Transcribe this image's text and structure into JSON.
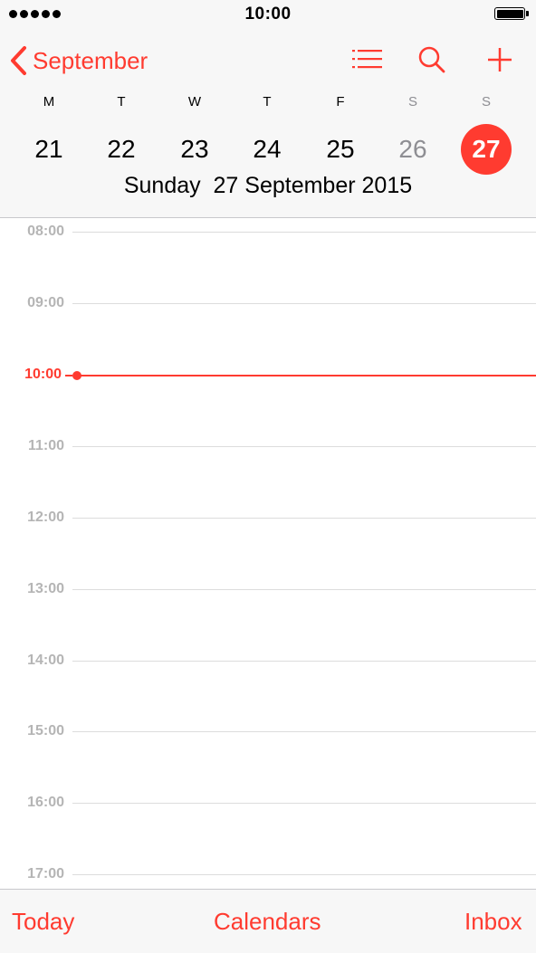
{
  "status_bar": {
    "time": "10:00",
    "signal_bars": 5
  },
  "nav": {
    "back_label": "September",
    "icons": [
      "list-icon",
      "search-icon",
      "plus-icon"
    ]
  },
  "week": {
    "days": [
      {
        "letter": "M",
        "number": "21",
        "weekend": false,
        "selected": false
      },
      {
        "letter": "T",
        "number": "22",
        "weekend": false,
        "selected": false
      },
      {
        "letter": "W",
        "number": "23",
        "weekend": false,
        "selected": false
      },
      {
        "letter": "T",
        "number": "24",
        "weekend": false,
        "selected": false
      },
      {
        "letter": "F",
        "number": "25",
        "weekend": false,
        "selected": false
      },
      {
        "letter": "S",
        "number": "26",
        "weekend": true,
        "selected": false
      },
      {
        "letter": "S",
        "number": "27",
        "weekend": true,
        "selected": true
      }
    ],
    "date_title": "Sunday  27 September 2015"
  },
  "timeline": {
    "hours": [
      "08:00",
      "09:00",
      "10:00",
      "11:00",
      "12:00",
      "13:00",
      "14:00",
      "15:00",
      "16:00",
      "17:00"
    ],
    "current_time": "10:00"
  },
  "tabbar": {
    "today": "Today",
    "calendars": "Calendars",
    "inbox": "Inbox"
  },
  "colors": {
    "accent": "#ff3b30",
    "header_bg": "#f7f7f7",
    "muted": "#8e8e93"
  }
}
